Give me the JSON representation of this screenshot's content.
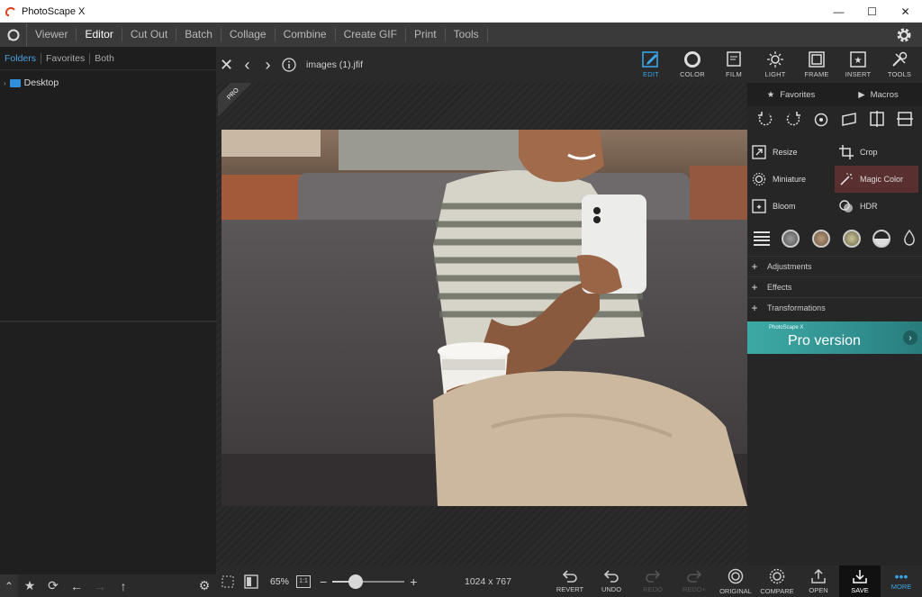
{
  "window": {
    "title": "PhotoScape X",
    "controls": [
      "—",
      "☐",
      "✕"
    ]
  },
  "menu": {
    "items": [
      "Viewer",
      "Editor",
      "Cut Out",
      "Batch",
      "Collage",
      "Combine",
      "Create GIF",
      "Print",
      "Tools"
    ],
    "active": "Editor"
  },
  "left_panel": {
    "tabs": [
      "Folders",
      "Favorites",
      "Both"
    ],
    "active_tab": "Folders",
    "tree": [
      {
        "label": "Desktop"
      }
    ]
  },
  "editor": {
    "filename": "images (1).jfif",
    "pro_badge": "PRO"
  },
  "toolbar": {
    "tools": [
      {
        "label": "EDIT",
        "icon": "edit-icon",
        "active": true
      },
      {
        "label": "COLOR",
        "icon": "color-icon",
        "active": false
      },
      {
        "label": "FILM",
        "icon": "film-icon",
        "active": false
      },
      {
        "label": "LIGHT",
        "icon": "light-icon",
        "active": false
      },
      {
        "label": "FRAME",
        "icon": "frame-icon",
        "active": false
      },
      {
        "label": "INSERT",
        "icon": "insert-icon",
        "active": false
      },
      {
        "label": "TOOLS",
        "icon": "tools-icon",
        "active": false
      }
    ]
  },
  "right_panel": {
    "tabs": {
      "favorites": "Favorites",
      "macros": "Macros"
    },
    "tools": {
      "resize": "Resize",
      "crop": "Crop",
      "miniature": "Miniature",
      "magic_color": "Magic Color",
      "bloom": "Bloom",
      "hdr": "HDR"
    },
    "sections": {
      "adjustments": "Adjustments",
      "effects": "Effects",
      "transformations": "Transformations"
    },
    "pro_banner": {
      "small": "PhotoScape X",
      "pro": "Pro",
      "version": " version"
    }
  },
  "bottom_bar": {
    "zoom": "65%",
    "one_to_one": "1:1",
    "zoom_level": 0.32,
    "dimensions": "1024 x 767",
    "actions": [
      {
        "label": "REVERT",
        "enabled": true
      },
      {
        "label": "UNDO",
        "enabled": true
      },
      {
        "label": "REDO",
        "enabled": false
      },
      {
        "label": "REDO+",
        "enabled": false
      },
      {
        "label": "ORIGINAL",
        "enabled": true
      },
      {
        "label": "COMPARE",
        "enabled": true
      },
      {
        "label": "OPEN",
        "enabled": true
      },
      {
        "label": "SAVE",
        "enabled": true
      },
      {
        "label": "MORE",
        "enabled": true
      }
    ]
  },
  "colors": {
    "accent": "#3aa5e8",
    "highlight": "#5a2f2f",
    "pro_banner": "#3da9a5"
  }
}
